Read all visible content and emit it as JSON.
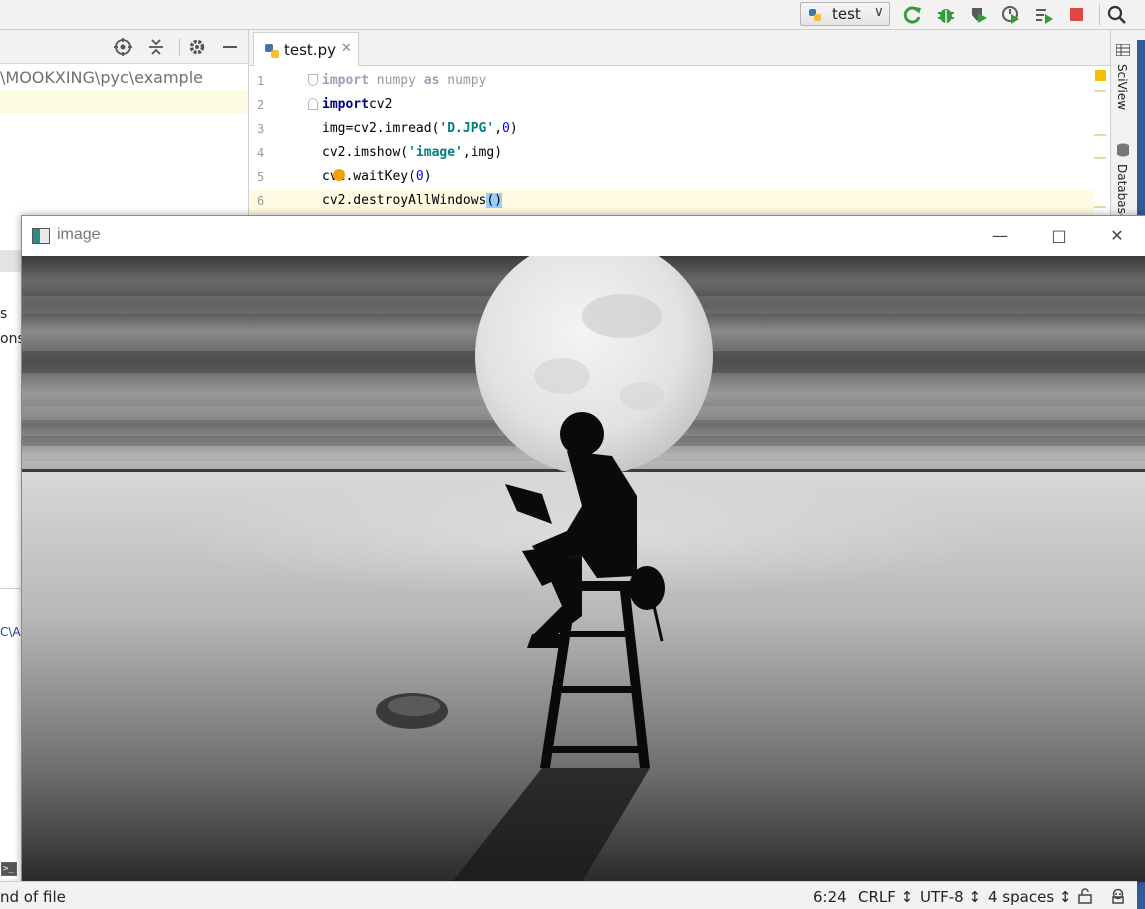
{
  "toolbar": {
    "run_config": "test"
  },
  "project_panel": {
    "path": "\\MOOKXING\\pyc\\example"
  },
  "editor": {
    "tab_label": "test.py",
    "lines": [
      {
        "n": "1",
        "segments": [
          [
            "kw-dim",
            "import"
          ],
          [
            "dim",
            " numpy "
          ],
          [
            "kw-dim",
            "as"
          ],
          [
            "dim",
            " numpy"
          ]
        ]
      },
      {
        "n": "2",
        "segments": [
          [
            "kw",
            "import"
          ],
          [
            "",
            "cv2"
          ]
        ]
      },
      {
        "n": "3",
        "segments": [
          [
            "",
            "img=cv2.imread("
          ],
          [
            "str",
            "'D.JPG'"
          ],
          [
            "",
            ","
          ],
          [
            "num",
            "0"
          ],
          [
            "",
            ")"
          ]
        ]
      },
      {
        "n": "4",
        "segments": [
          [
            "",
            "cv2.imshow("
          ],
          [
            "str",
            "'image'"
          ],
          [
            "",
            ",img)"
          ]
        ]
      },
      {
        "n": "5",
        "segments": [
          [
            "",
            "cv2.waitKey("
          ],
          [
            "num",
            "0"
          ],
          [
            "",
            ")"
          ]
        ]
      },
      {
        "n": "6",
        "segments": [
          [
            "",
            "cv2.destroyAllWindows"
          ],
          [
            "paren-hl",
            "()"
          ]
        ]
      }
    ]
  },
  "right_strip": {
    "sciview": "SciView",
    "database": "Database"
  },
  "background": {
    "left_text_1": "s",
    "left_text_2": "ons",
    "left_text_3": "C\\A"
  },
  "image_window": {
    "title": "image"
  },
  "status_bar": {
    "message": "nd of file",
    "position": "6:24",
    "line_ending": "CRLF ↕",
    "encoding": "UTF-8 ↕",
    "indent": "4 spaces ↕"
  }
}
